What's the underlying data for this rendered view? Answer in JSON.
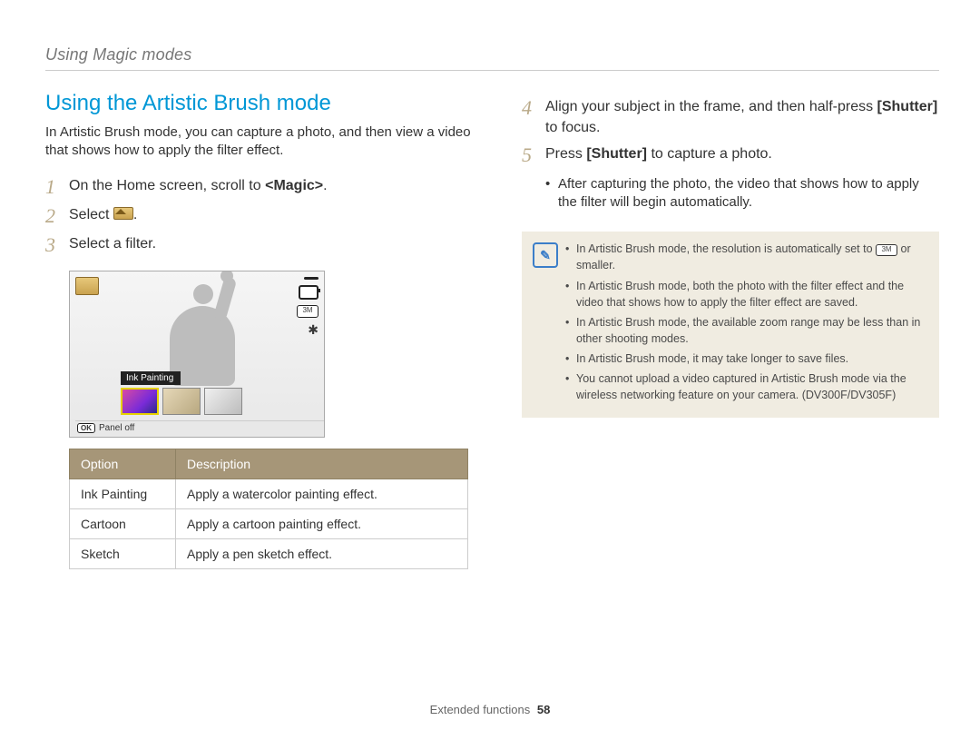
{
  "header": {
    "section": "Using Magic modes"
  },
  "title": "Using the Artistic Brush mode",
  "intro": "In Artistic Brush mode, you can capture a photo, and then view a video that shows how to apply the filter effect.",
  "steps": {
    "s1_pre": "On the Home screen, scroll to ",
    "s1_mid": "<Magic>",
    "s1_post": ".",
    "s2_pre": "Select ",
    "s2_post": ".",
    "s3": "Select a filter.",
    "s4_a": "Align your subject in the frame, and then half-press ",
    "s4_b": "[Shutter]",
    "s4_c": " to focus.",
    "s5_a": "Press ",
    "s5_b": "[Shutter]",
    "s5_c": " to capture a photo.",
    "s5_sub": "After capturing the photo, the video that shows how to apply the filter will begin automatically."
  },
  "screen": {
    "label": "Ink Painting",
    "ok": "OK",
    "panel": "Panel off",
    "res": "3M"
  },
  "table": {
    "h1": "Option",
    "h2": "Description",
    "r1c1": "Ink Painting",
    "r1c2": "Apply a watercolor painting effect.",
    "r2c1": "Cartoon",
    "r2c2": "Apply a cartoon painting effect.",
    "r3c1": "Sketch",
    "r3c2": "Apply a pen sketch effect."
  },
  "notes": {
    "n1a": "In Artistic Brush mode, the resolution is automatically set to ",
    "n1chip": "3M",
    "n1b": " or smaller.",
    "n2": "In Artistic Brush mode, both the photo with the filter effect and the video that shows how to apply the filter effect are saved.",
    "n3": "In Artistic Brush mode, the available zoom range may be less than in other shooting modes.",
    "n4": "In Artistic Brush mode, it may take longer to save files.",
    "n5": "You cannot upload a video captured in Artistic Brush mode via the wireless networking feature on your camera. (DV300F/DV305F)"
  },
  "footer": {
    "label": "Extended functions",
    "page": "58"
  },
  "note_icon": "✎"
}
